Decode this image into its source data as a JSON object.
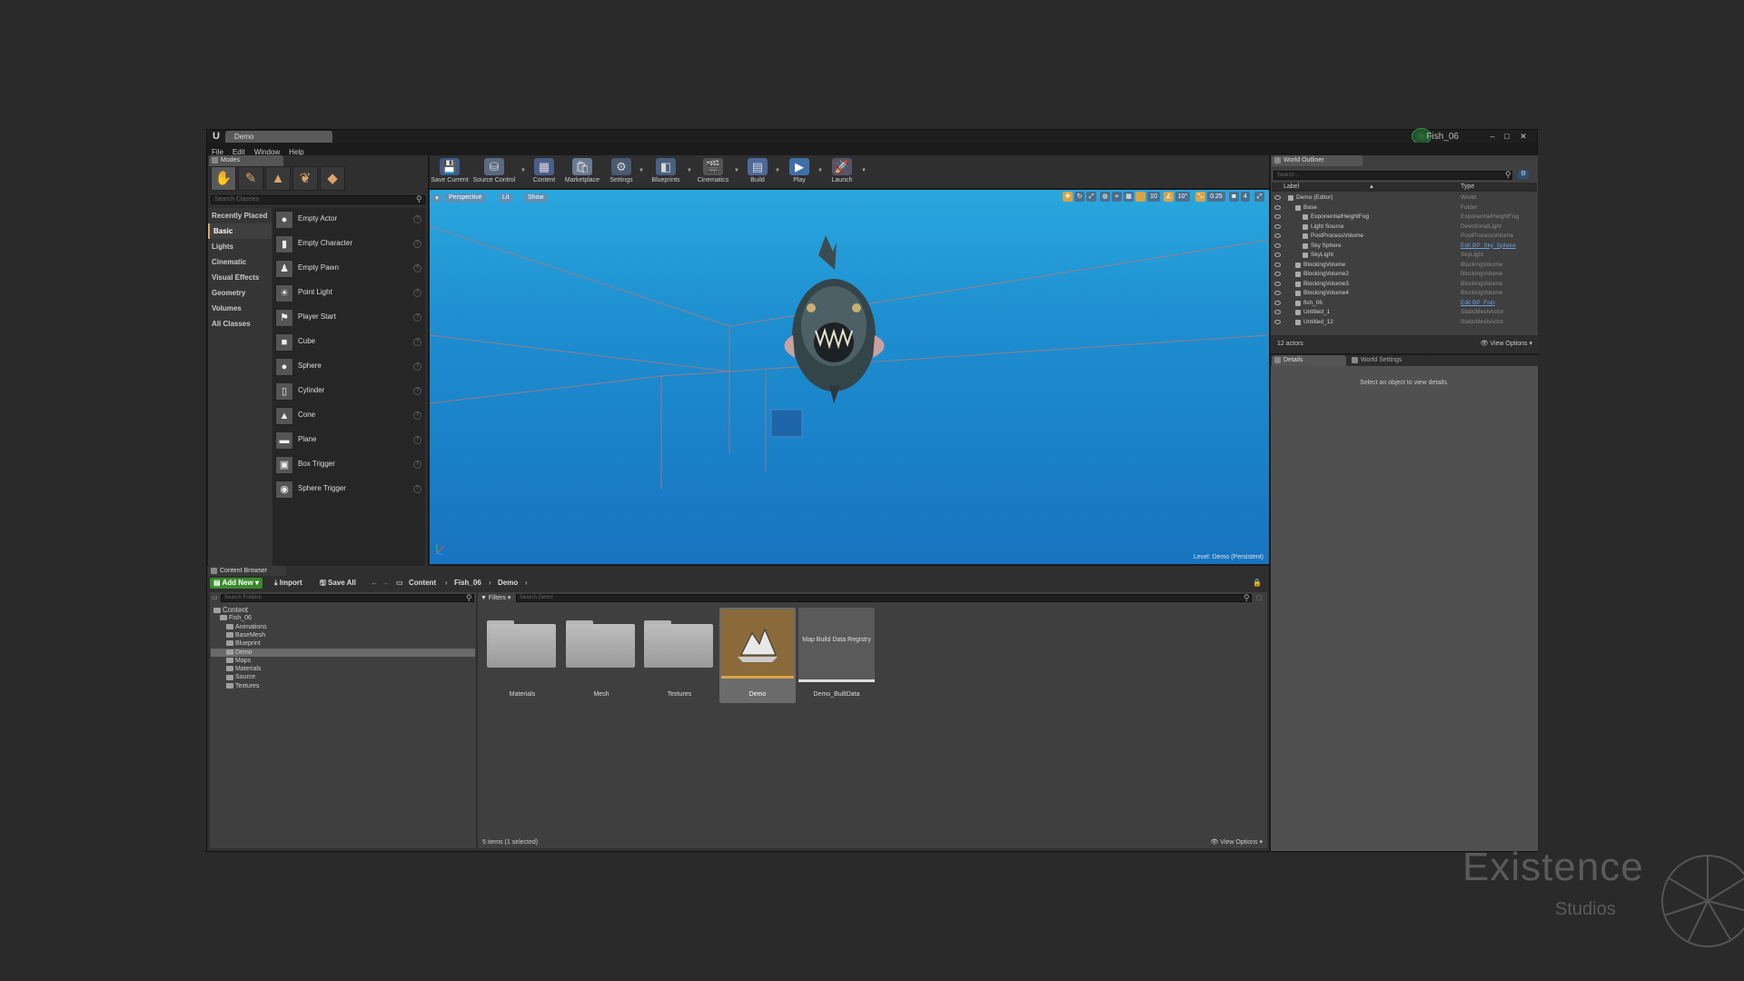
{
  "window": {
    "doc_tab": "Demo",
    "project_name": "Fish_06",
    "min": "–",
    "max": "□",
    "close": "✕"
  },
  "menu": [
    "File",
    "Edit",
    "Window",
    "Help"
  ],
  "modes": {
    "tab_label": "Modes",
    "search_placeholder": "Search Classes",
    "categories": [
      "Recently Placed",
      "Basic",
      "Lights",
      "Cinematic",
      "Visual Effects",
      "Geometry",
      "Volumes",
      "All Classes"
    ],
    "selected_category": "Basic",
    "actors": [
      "Empty Actor",
      "Empty Character",
      "Empty Pawn",
      "Point Light",
      "Player Start",
      "Cube",
      "Sphere",
      "Cylinder",
      "Cone",
      "Plane",
      "Box Trigger",
      "Sphere Trigger"
    ]
  },
  "toolbar": {
    "buttons": [
      {
        "label": "Save Current",
        "icon": "save-icon"
      },
      {
        "label": "Source Control",
        "icon": "source-control-icon"
      },
      {
        "label": "Content",
        "icon": "content-icon"
      },
      {
        "label": "Marketplace",
        "icon": "marketplace-icon"
      },
      {
        "label": "Settings",
        "icon": "settings-icon"
      },
      {
        "label": "Blueprints",
        "icon": "blueprints-icon"
      },
      {
        "label": "Cinematics",
        "icon": "cinematics-icon"
      },
      {
        "label": "Build",
        "icon": "build-icon"
      },
      {
        "label": "Play",
        "icon": "play-icon"
      },
      {
        "label": "Launch",
        "icon": "launch-icon"
      }
    ]
  },
  "viewport": {
    "perspective": "Perspective",
    "lit": "Lit",
    "show": "Show",
    "grid_snap": "10",
    "rot_snap": "10°",
    "scale_snap": "0.25",
    "camera_speed": "4",
    "level_label": "Level:  Demo (Persistent)"
  },
  "outliner": {
    "tab_label": "World Outliner",
    "search_placeholder": "Search...",
    "col_label": "Label",
    "col_type": "Type",
    "rows": [
      {
        "label": "Demo (Editor)",
        "type": "World",
        "indent": 0,
        "link": false
      },
      {
        "label": "Base",
        "type": "Folder",
        "indent": 1,
        "link": false
      },
      {
        "label": "ExponentialHeightFog",
        "type": "ExponentialHeightFog",
        "indent": 2,
        "link": false
      },
      {
        "label": "Light Source",
        "type": "DirectionalLight",
        "indent": 2,
        "link": false
      },
      {
        "label": "PostProcessVolume",
        "type": "PostProcessVolume",
        "indent": 2,
        "link": false
      },
      {
        "label": "Sky Sphere",
        "type": "Edit BP_Sky_Sphere",
        "indent": 2,
        "link": true
      },
      {
        "label": "SkyLight",
        "type": "SkyLight",
        "indent": 2,
        "link": false
      },
      {
        "label": "BlockingVolume",
        "type": "BlockingVolume",
        "indent": 1,
        "link": false
      },
      {
        "label": "BlockingVolume2",
        "type": "BlockingVolume",
        "indent": 1,
        "link": false
      },
      {
        "label": "BlockingVolume3",
        "type": "BlockingVolume",
        "indent": 1,
        "link": false
      },
      {
        "label": "BlockingVolume4",
        "type": "BlockingVolume",
        "indent": 1,
        "link": false
      },
      {
        "label": "fish_06",
        "type": "Edit BP_Fish",
        "indent": 1,
        "link": true
      },
      {
        "label": "Untitled_1",
        "type": "StaticMeshActor",
        "indent": 1,
        "link": false
      },
      {
        "label": "Untitled_12",
        "type": "StaticMeshActor",
        "indent": 1,
        "link": false
      }
    ],
    "actor_count": "12 actors",
    "view_options": "View Options"
  },
  "details": {
    "tab_details": "Details",
    "tab_world_settings": "World Settings",
    "empty_message": "Select an object to view details."
  },
  "content_browser": {
    "tab_label": "Content Browser",
    "add_new": "Add New",
    "import": "Import",
    "save_all": "Save All",
    "path": [
      "Content",
      "Fish_06",
      "Demo"
    ],
    "folder_search_placeholder": "Search Folders",
    "asset_search_placeholder": "Search Demo",
    "filters": "Filters",
    "tree": [
      {
        "label": "Content",
        "depth": 0
      },
      {
        "label": "Fish_06",
        "depth": 1
      },
      {
        "label": "Animations",
        "depth": 2
      },
      {
        "label": "BaseMesh",
        "depth": 2
      },
      {
        "label": "Blueprint",
        "depth": 2
      },
      {
        "label": "Demo",
        "depth": 2,
        "selected": true
      },
      {
        "label": "Maps",
        "depth": 2
      },
      {
        "label": "Materials",
        "depth": 2
      },
      {
        "label": "Source",
        "depth": 2
      },
      {
        "label": "Textures",
        "depth": 2
      }
    ],
    "assets": [
      {
        "name": "Materials",
        "kind": "folder"
      },
      {
        "name": "Mesh",
        "kind": "folder"
      },
      {
        "name": "Textures",
        "kind": "folder"
      },
      {
        "name": "Demo",
        "kind": "level",
        "selected": true
      },
      {
        "name": "Demo_BuiltData",
        "kind": "data",
        "thumb_text": "Map Build Data Registry"
      }
    ],
    "status": "5 items (1 selected)",
    "view_options": "View Options"
  },
  "watermark": {
    "title": "Existence",
    "subtitle": "Studios"
  }
}
